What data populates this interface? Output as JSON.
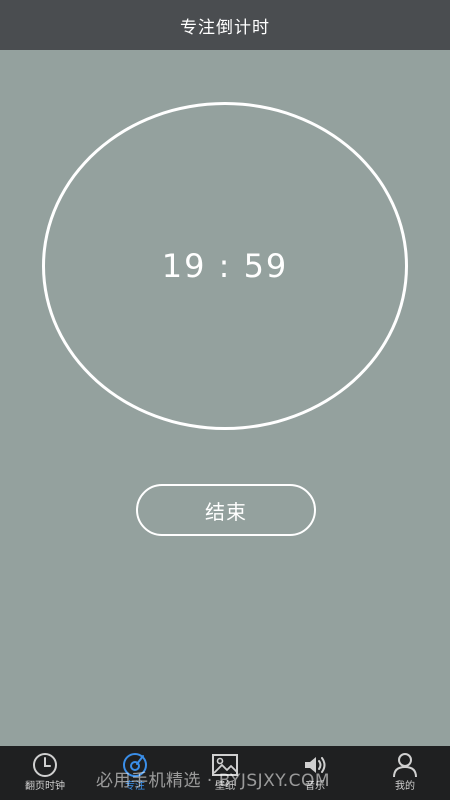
{
  "header": {
    "title": "专注倒计时"
  },
  "timer": {
    "display": "19 : 59"
  },
  "actions": {
    "end_label": "结束"
  },
  "tabbar": {
    "items": [
      {
        "label": "翻页时钟",
        "icon": "clock-icon"
      },
      {
        "label": "专注",
        "icon": "focus-icon",
        "active": true
      },
      {
        "label": "壁纸",
        "icon": "wallpaper-icon"
      },
      {
        "label": "音乐",
        "icon": "speaker-icon"
      },
      {
        "label": "我的",
        "icon": "user-icon"
      }
    ]
  },
  "watermark": {
    "text": "必用手机精选 · BYJSJXY.COM"
  },
  "colors": {
    "background": "#94a19e",
    "header": "#4a4d50",
    "tabbar": "#1f2021",
    "active": "#3a8ee8"
  }
}
